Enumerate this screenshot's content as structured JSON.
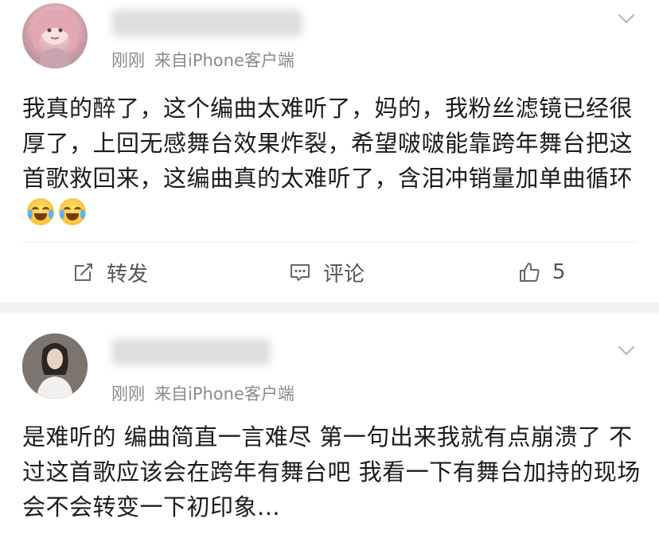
{
  "posts": [
    {
      "meta": {
        "time": "刚刚",
        "source": "来自iPhone客户端"
      },
      "content": "我真的醉了，这个编曲太难听了，妈的，我粉丝滤镜已经很厚了，上回无感舞台效果炸裂，希望啵啵能靠跨年舞台把这首歌救回来，这编曲真的太难听了，含泪冲销量加单曲循环",
      "emojis": [
        "laugh-cry-emoji",
        "laugh-cry-emoji"
      ],
      "actions": {
        "repost": "转发",
        "comment": "评论",
        "like_count": "5"
      }
    },
    {
      "meta": {
        "time": "刚刚",
        "source": "来自iPhone客户端"
      },
      "content": "是难听的 编曲简直一言难尽 第一句出来我就有点崩溃了 不过这首歌应该会在跨年有舞台吧 我看一下有舞台加持的现场会不会转变一下初印象..."
    }
  ],
  "icons": {
    "repost": "edit-square-icon",
    "comment": "comment-icon",
    "like": "thumbs-up-icon",
    "menu": "chevron-down-icon"
  },
  "colors": {
    "separator": "#f2f2f2",
    "meta_text": "#8a8a8a",
    "body_text": "#1c1c1c"
  }
}
